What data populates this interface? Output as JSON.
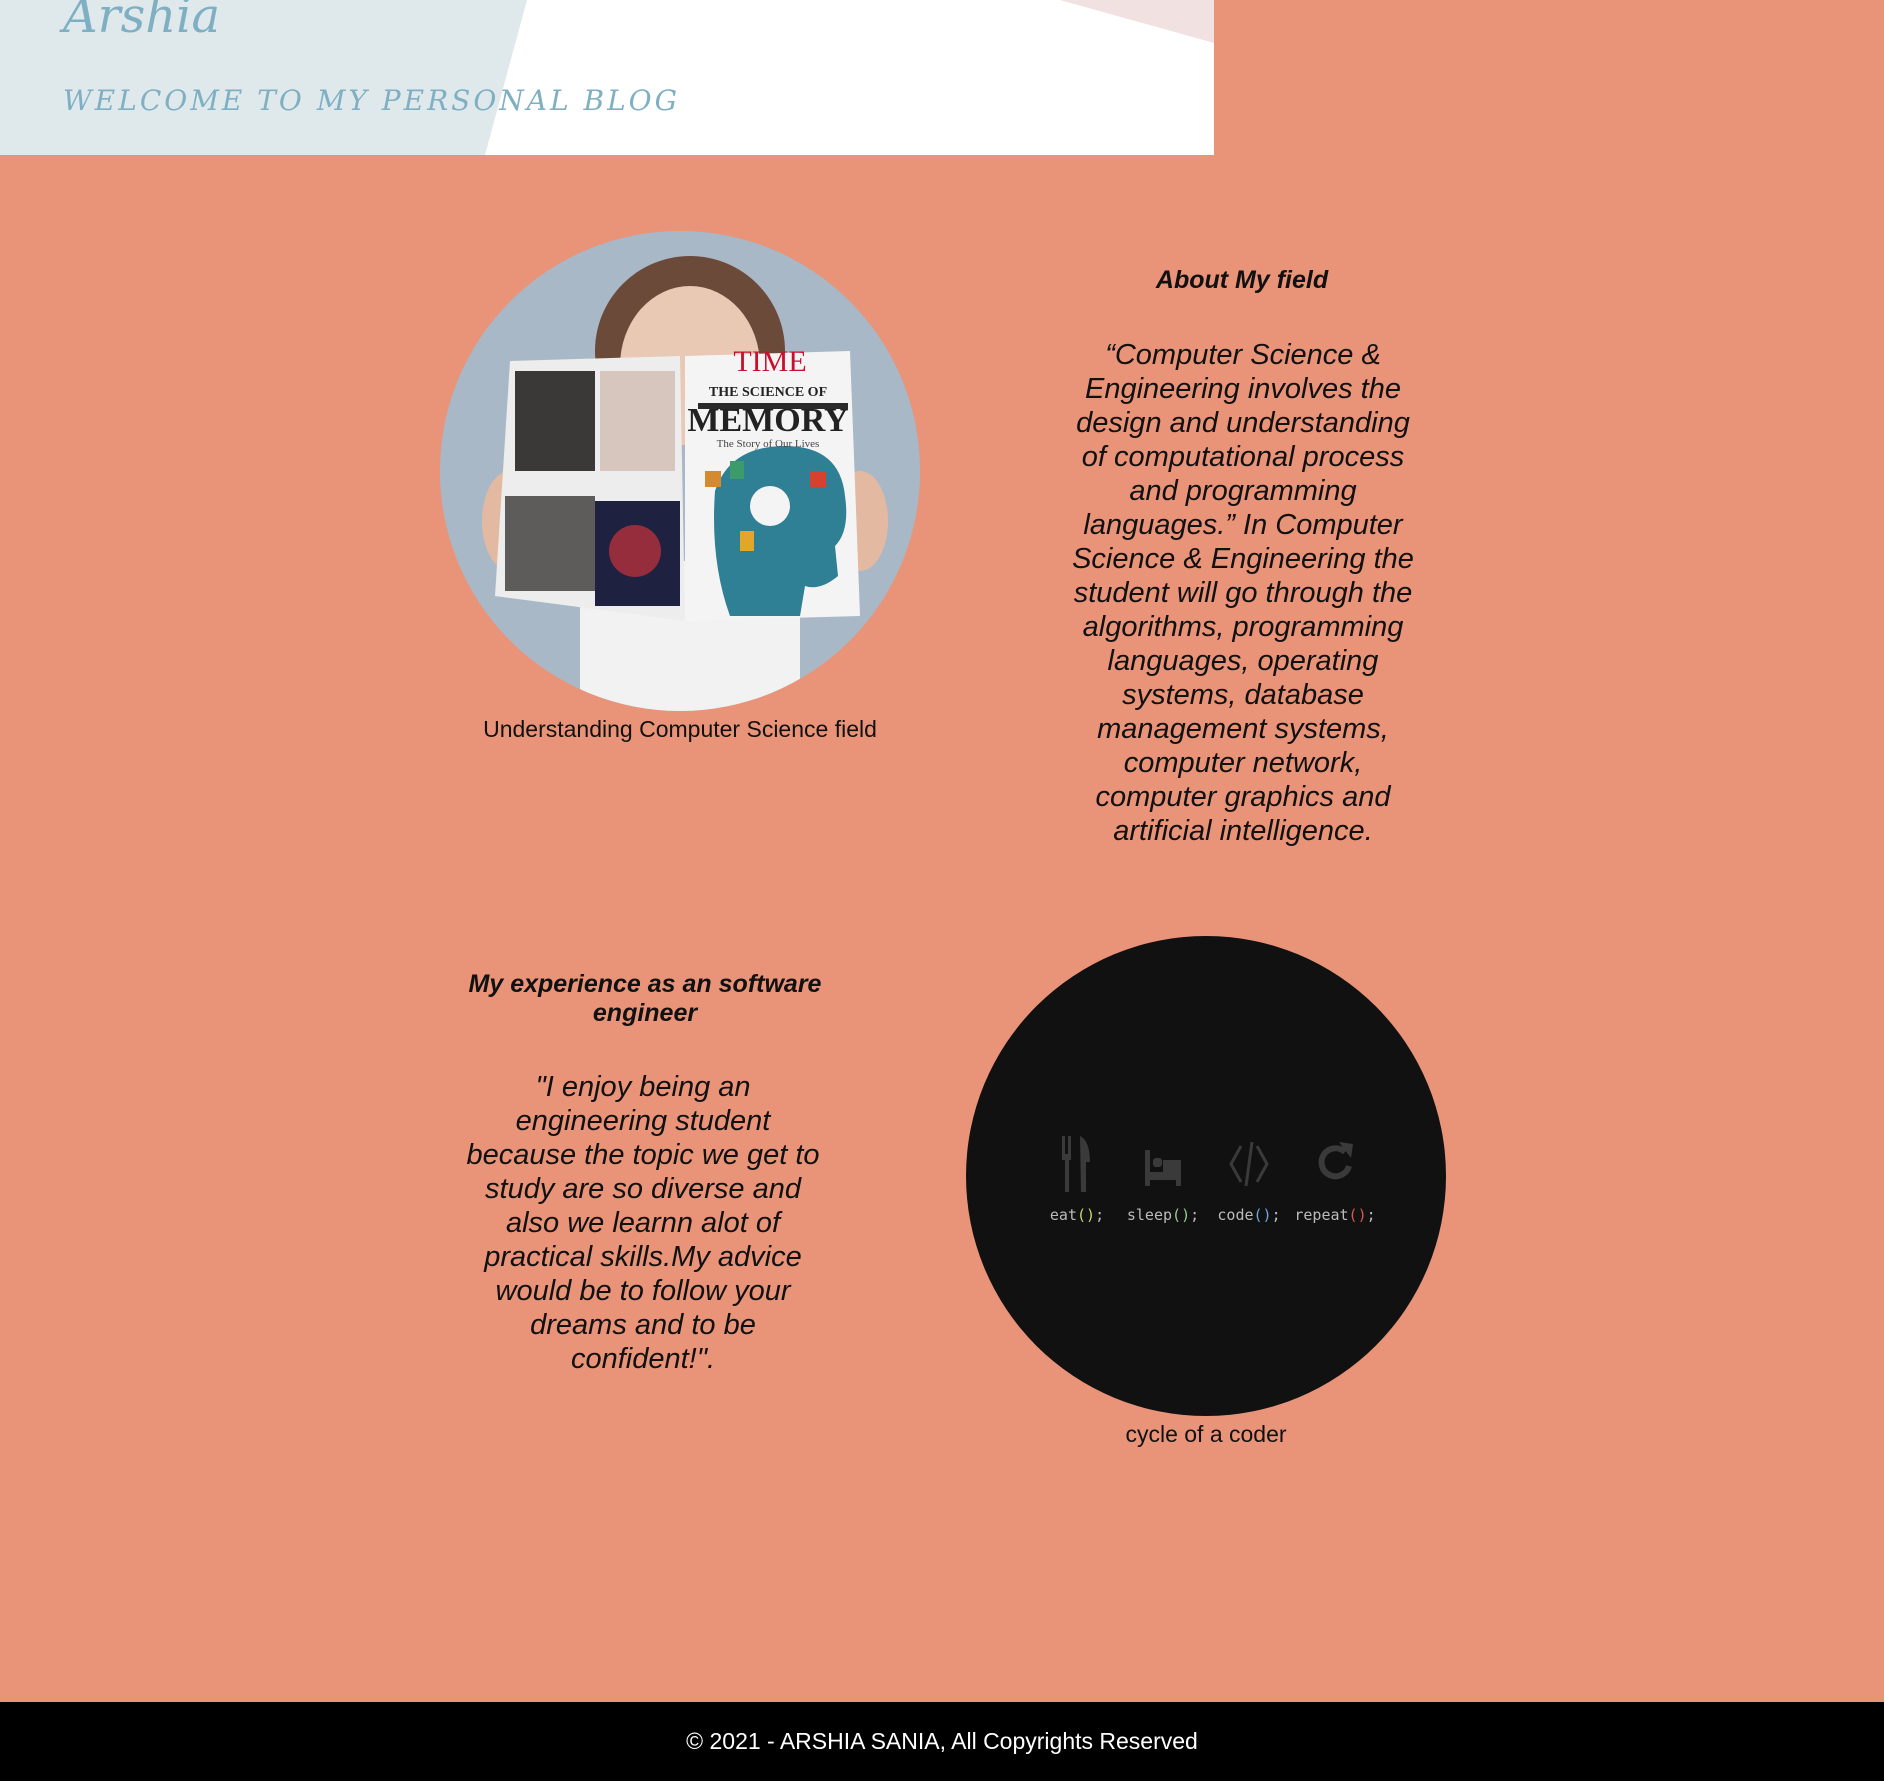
{
  "header": {
    "title": "Arshia",
    "tagline": "WELCOME TO MY PERSONAL BLOG"
  },
  "section1": {
    "image_caption": "Understanding Computer Science field",
    "magazine": {
      "brand": "TIME",
      "title_line1": "THE SCIENCE OF",
      "title_line2": "MEMORY",
      "subtitle": "The Story of Our Lives"
    },
    "heading": "About My field",
    "quote": "“Computer Science & Engineering involves the design and understanding of computational process and programming languages.” In Computer Science & Engineering the student will go through the algorithms, programming languages, operating systems, database management systems, computer network, computer graphics and artificial intelligence."
  },
  "section2": {
    "heading": "My experience as an software engineer",
    "quote": "\"I enjoy being an engineering student because the topic we get to study are so diverse and also we learnn alot of practical skills.My advice would be to follow your dreams and to be confident!\".",
    "image_caption": "cycle of a coder",
    "coder_cycle": [
      {
        "label": "eat",
        "icon": "fork-knife-icon"
      },
      {
        "label": "sleep",
        "icon": "bed-icon"
      },
      {
        "label": "code",
        "icon": "code-icon"
      },
      {
        "label": "repeat",
        "icon": "repeat-icon"
      }
    ],
    "code_suffix_open": "(",
    "code_suffix_close": ")",
    "code_semicolon": ";"
  },
  "footer": {
    "copyright": "© 2021 - ARSHIA SANIA, All Copyrights Reserved"
  },
  "colors": {
    "background": "#E99478",
    "header_accent": "#7FAFC2",
    "footer": "#000000"
  }
}
